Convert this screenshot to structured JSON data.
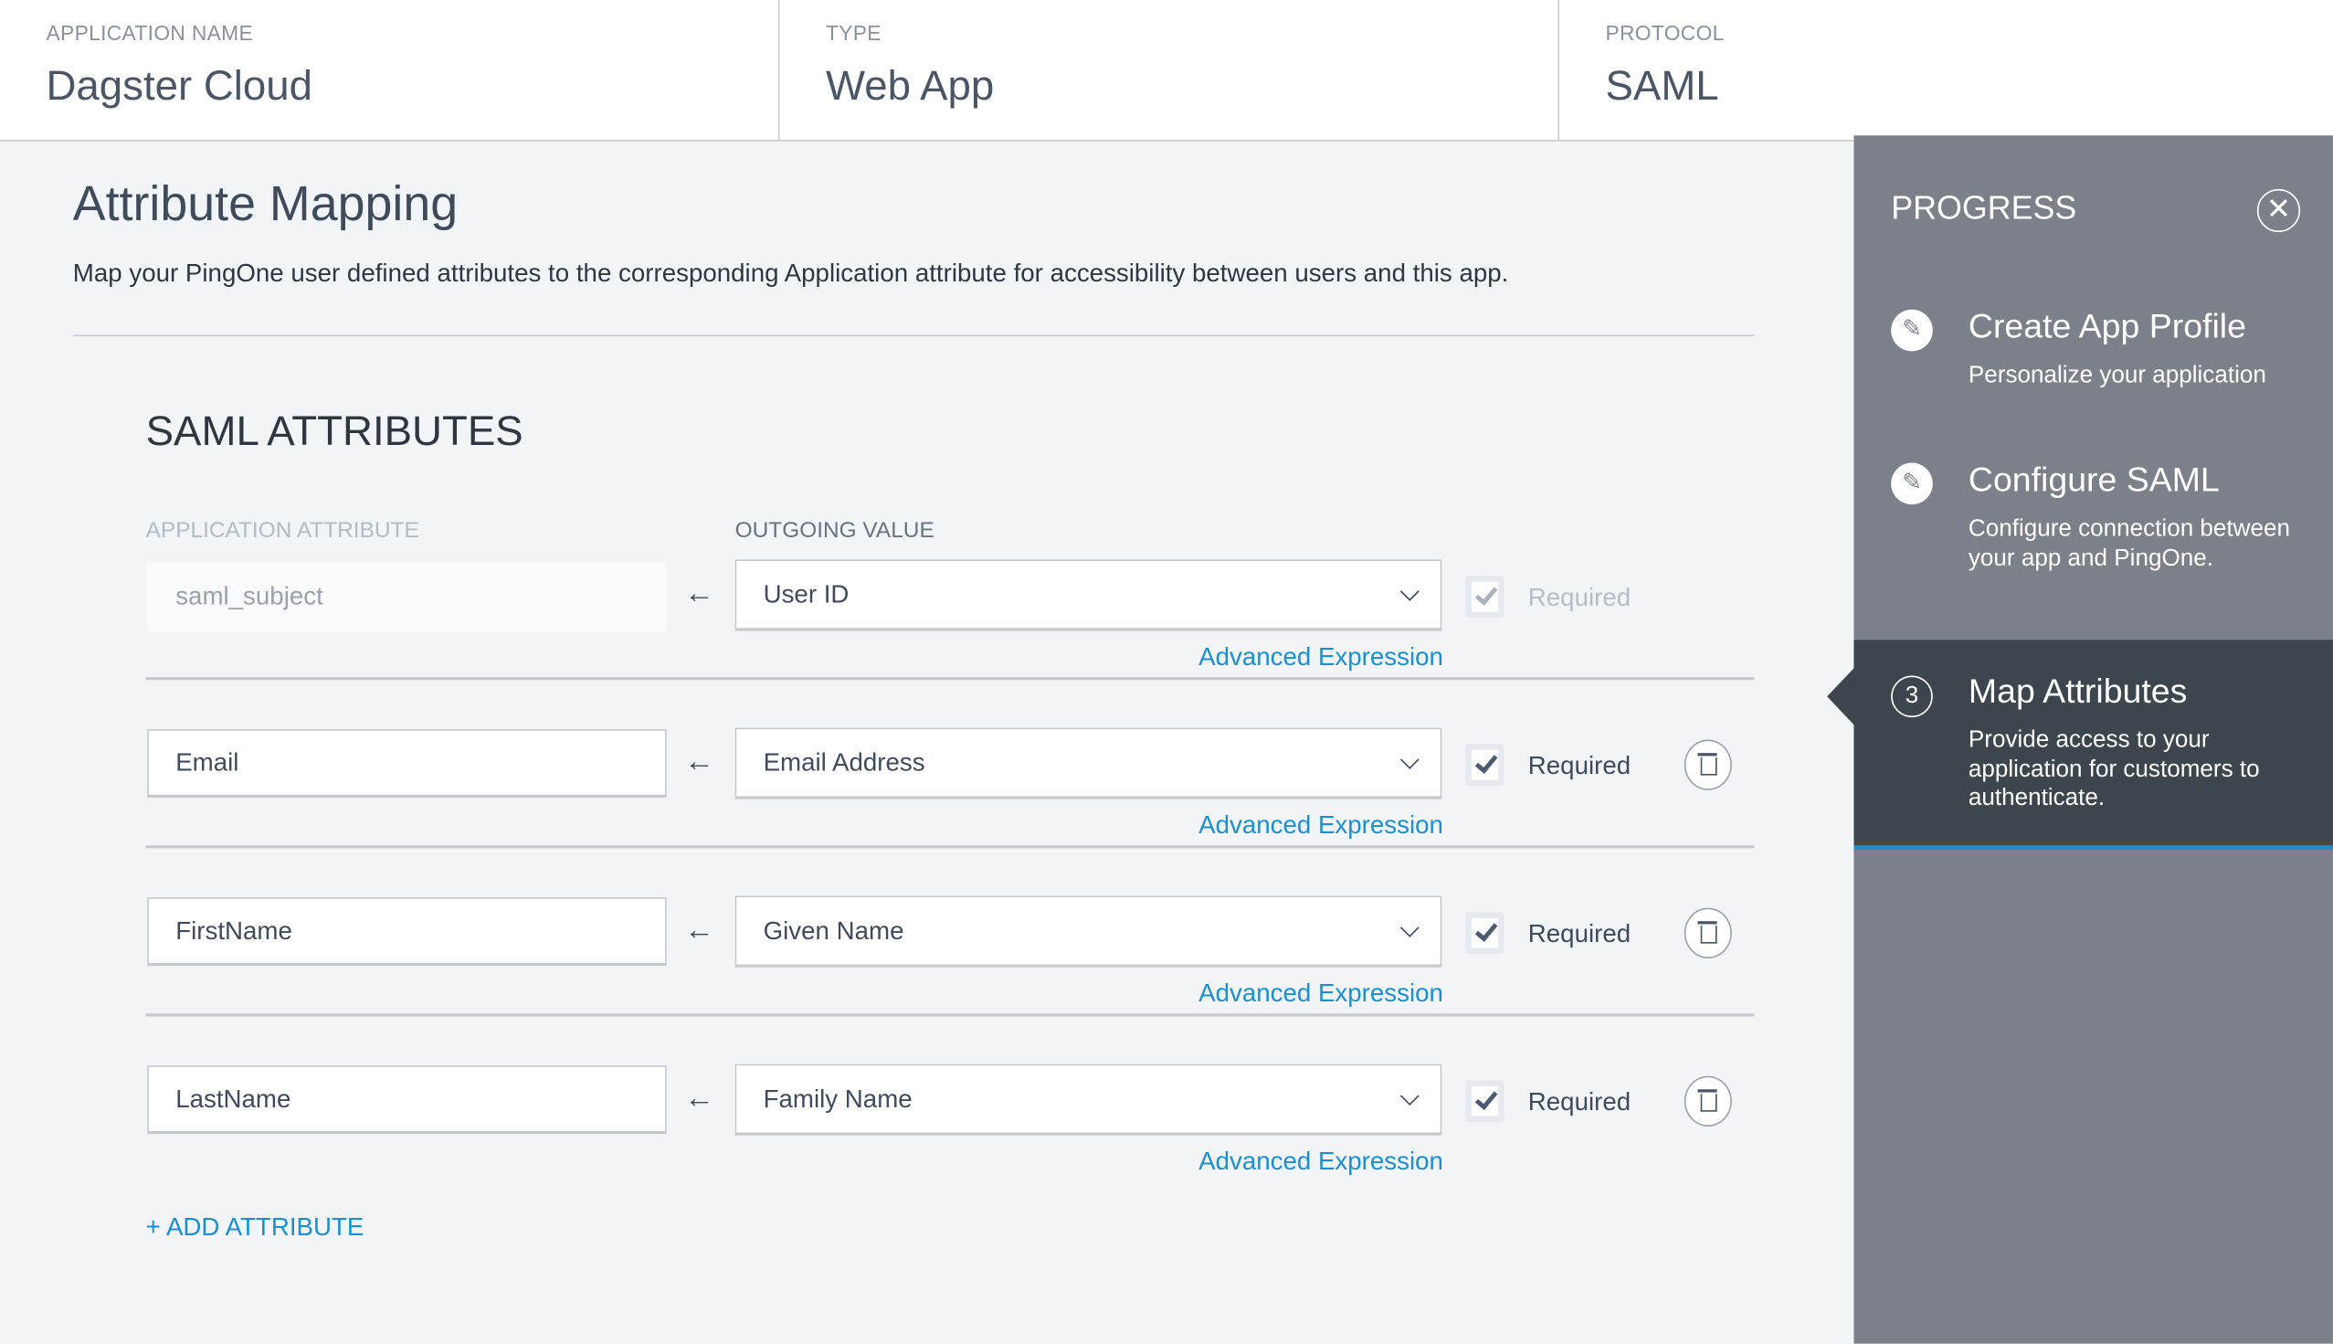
{
  "header": {
    "app_name_label": "APPLICATION NAME",
    "app_name": "Dagster Cloud",
    "type_label": "TYPE",
    "type": "Web App",
    "protocol_label": "PROTOCOL",
    "protocol": "SAML"
  },
  "main": {
    "title": "Attribute Mapping",
    "description": "Map your PingOne user defined attributes to the corresponding Application attribute for accessibility between users and this app.",
    "section_title": "SAML ATTRIBUTES",
    "col_app_attr": "APPLICATION ATTRIBUTE",
    "col_outgoing": "OUTGOING VALUE",
    "arrow": "←",
    "required_label": "Required",
    "advanced_label": "Advanced Expression",
    "add_label": "+ ADD ATTRIBUTE",
    "rows": [
      {
        "attribute": "saml_subject",
        "value": "User ID",
        "required": true,
        "disabled": true
      },
      {
        "attribute": "Email",
        "value": "Email Address",
        "required": true,
        "disabled": false
      },
      {
        "attribute": "FirstName",
        "value": "Given Name",
        "required": true,
        "disabled": false
      },
      {
        "attribute": "LastName",
        "value": "Family Name",
        "required": true,
        "disabled": false
      }
    ]
  },
  "progress": {
    "title": "PROGRESS",
    "close_icon": "✕",
    "steps": [
      {
        "icon": "pencil-icon",
        "glyph": "✎",
        "title": "Create App Profile",
        "subtitle": "Personalize your application"
      },
      {
        "icon": "pencil-icon",
        "glyph": "✎",
        "title": "Configure SAML",
        "subtitle": "Configure connection between your app and PingOne."
      },
      {
        "icon": "step-number",
        "glyph": "3",
        "title": "Map Attributes",
        "subtitle": "Provide access to your application for customers to authenticate.",
        "active": true
      }
    ]
  },
  "colors": {
    "accent": "#1a8fd0",
    "sidebar": "#7b8089",
    "active_step": "#3d454d"
  }
}
